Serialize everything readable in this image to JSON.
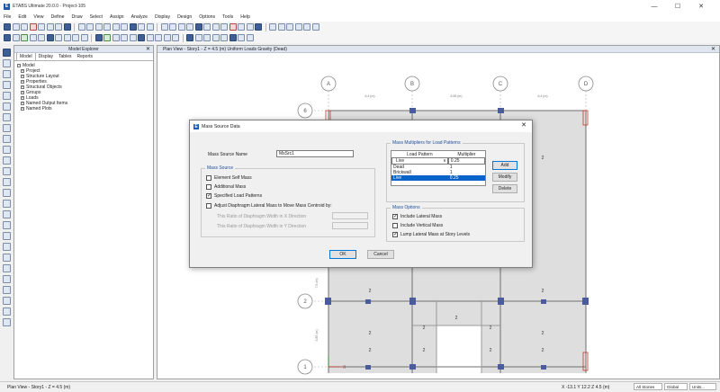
{
  "app": {
    "title": "ETABS Ultimate 20.0.0 - Project-105",
    "icon_letter": "E",
    "controls": {
      "minimize": "—",
      "maximize": "☐",
      "close": "✕"
    }
  },
  "menu": [
    "File",
    "Edit",
    "View",
    "Define",
    "Draw",
    "Select",
    "Assign",
    "Analyze",
    "Display",
    "Design",
    "Options",
    "Tools",
    "Help"
  ],
  "explorer": {
    "title": "Model Explorer",
    "close": "✕",
    "tabs": [
      "Model",
      "Display",
      "Tables",
      "Reports"
    ],
    "root": "Model",
    "items": [
      "Project",
      "Structure Layout",
      "Properties",
      "Structural Objects",
      "Groups",
      "Loads",
      "Named Output Items",
      "Named Plots"
    ]
  },
  "plan": {
    "title": "Plan View - Story1 - Z = 4.5 (m)  Uniform Loads Gravity (Dead)",
    "close": "✕",
    "grid_columns": [
      "A",
      "B",
      "C",
      "D"
    ],
    "grid_rows": [
      "6",
      "2",
      "1"
    ],
    "dims": [
      "6.4 (m)",
      "6.55 (m)",
      "6.4 (m)"
    ],
    "side_dims": [
      "7.5 (m)",
      "3.85 (m)"
    ],
    "load_label": "2"
  },
  "status": {
    "left": "Plan View - Story1 - Z = 4.5 (m)",
    "coords": "X -13.1  Y 12.2  Z 4.5 (m)",
    "stories": "All Stories",
    "global": "Global",
    "units": "Units..."
  },
  "dialog": {
    "title": "Mass Source Data",
    "close": "✕",
    "name_label": "Mass Source Name",
    "name_value": "MsSrc1",
    "mass_source_group": "Mass Source",
    "mass_source_options": [
      {
        "label": "Element Self Mass",
        "checked": false
      },
      {
        "label": "Additional Mass",
        "checked": false
      },
      {
        "label": "Specified Load Patterns",
        "checked": true
      }
    ],
    "adjust_label": "Adjust Diaphragm Lateral Mass to Move Mass Centroid by:",
    "adjust_checked": false,
    "ratio_x_label": "This Ratio of Diaphragm Width in X Direction",
    "ratio_y_label": "This Ratio of Diaphragm Width in Y Direction",
    "multipliers_group": "Mass Multipliers for Load Patterns",
    "col_pattern": "Load Pattern",
    "col_multiplier": "Multiplier",
    "input_pattern": "Live",
    "input_multiplier": "0.25",
    "rows": [
      {
        "pattern": "Dead",
        "multiplier": "1",
        "selected": false
      },
      {
        "pattern": "Brickwall",
        "multiplier": "1",
        "selected": false
      },
      {
        "pattern": "Live",
        "multiplier": "0.25",
        "selected": true
      }
    ],
    "add": "Add",
    "modify": "Modify",
    "delete": "Delete",
    "options_group": "Mass Options",
    "mass_options": [
      {
        "label": "Include Lateral Mass",
        "checked": true
      },
      {
        "label": "Include Vertical Mass",
        "checked": false
      },
      {
        "label": "Lump Lateral Mass at Story Levels",
        "checked": true
      }
    ],
    "ok": "OK",
    "cancel": "Cancel"
  },
  "colors": {
    "accent": "#0a63c8",
    "group_title": "#1f4e99",
    "column_marker": "#4b5c9e"
  }
}
